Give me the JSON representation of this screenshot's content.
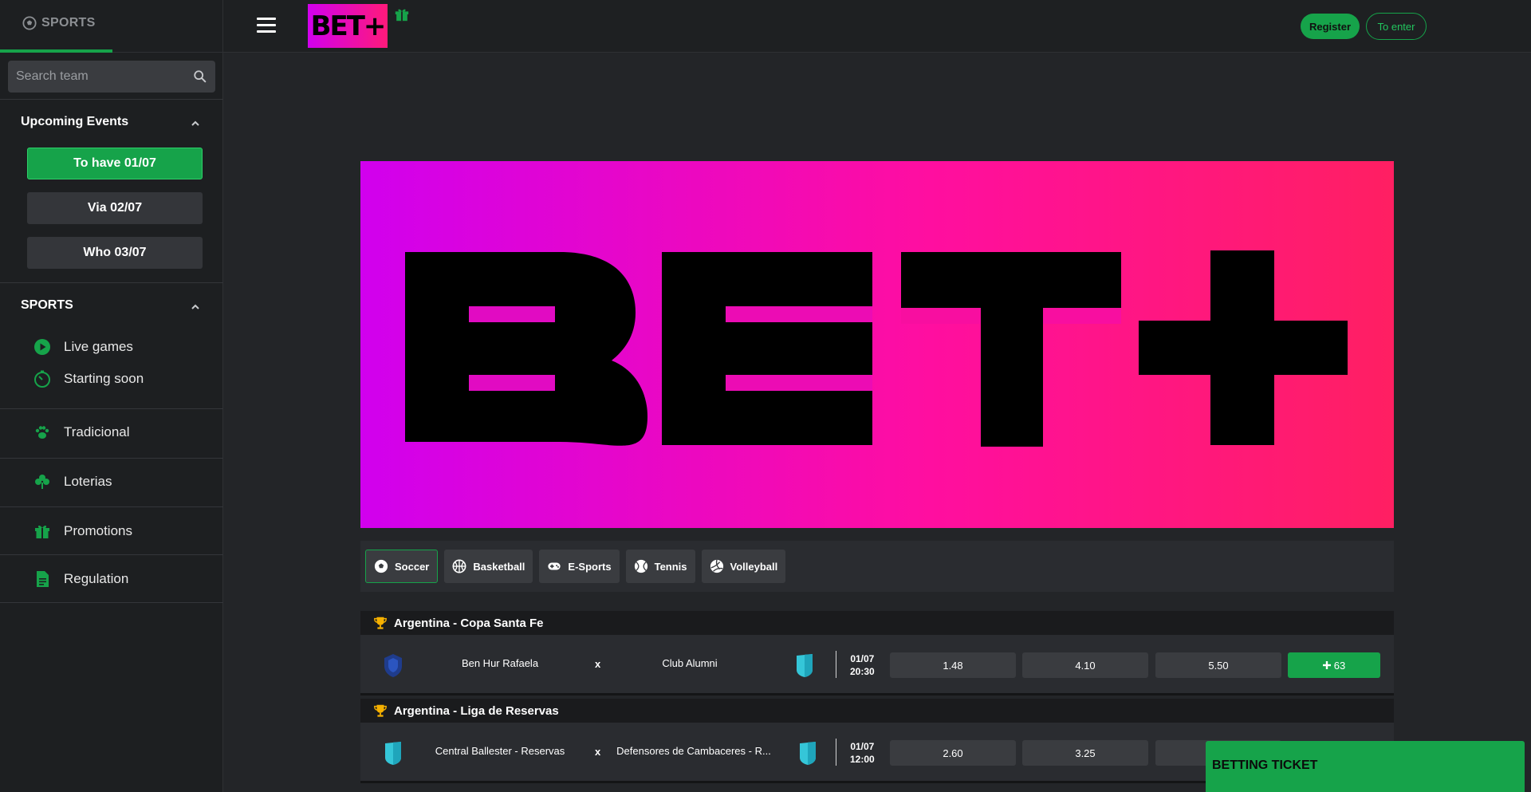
{
  "sidebar": {
    "sports_tab": "SPORTS",
    "search": {
      "placeholder": "Search team",
      "icon": "search-icon"
    },
    "upcoming": {
      "title": "Upcoming Events",
      "dates": [
        {
          "label": "To have  01/07",
          "active": true
        },
        {
          "label": "Via  02/07",
          "active": false
        },
        {
          "label": "Who  03/07",
          "active": false
        }
      ]
    },
    "sports_section": {
      "title": "SPORTS",
      "items": [
        {
          "label": "Live games",
          "icon": "play-icon"
        },
        {
          "label": "Starting soon",
          "icon": "timer-icon"
        }
      ]
    },
    "links": [
      {
        "label": "Tradicional",
        "icon": "paw-icon"
      },
      {
        "label": "Loterias",
        "icon": "clover-icon"
      },
      {
        "label": "Promotions",
        "icon": "gift-icon"
      },
      {
        "label": "Regulation",
        "icon": "document-icon"
      }
    ]
  },
  "header": {
    "logo": "BET+",
    "register_label": "Register",
    "enter_label": "To enter"
  },
  "banner": {
    "logo_text": "BET+"
  },
  "sport_tabs": [
    {
      "label": "Soccer",
      "icon": "soccer-ball-icon",
      "active": true
    },
    {
      "label": "Basketball",
      "icon": "basketball-icon",
      "active": false
    },
    {
      "label": "E-Sports",
      "icon": "gamepad-icon",
      "active": false
    },
    {
      "label": "Tennis",
      "icon": "tennis-ball-icon",
      "active": false
    },
    {
      "label": "Volleyball",
      "icon": "volleyball-icon",
      "active": false
    }
  ],
  "leagues": [
    {
      "name": "Argentina - Copa Santa Fe",
      "match": {
        "home": "Ben Hur Rafaela",
        "vs": "x",
        "away": "Club Alumni",
        "date": "01/07",
        "time": "20:30",
        "odds": [
          "1.48",
          "4.10",
          "5.50"
        ],
        "more": "63"
      }
    },
    {
      "name": "Argentina - Liga de Reservas",
      "match": {
        "home": "Central Ballester - Reservas",
        "vs": "x",
        "away": "Defensores de Cambaceres - R...",
        "date": "01/07",
        "time": "12:00",
        "odds": [
          "2.60",
          "3.25"
        ]
      }
    }
  ],
  "ticket": {
    "label": "BETTING TICKET"
  },
  "colors": {
    "accent": "#16a34a",
    "brand_start": "#d100ee",
    "brand_end": "#ff1f62"
  }
}
